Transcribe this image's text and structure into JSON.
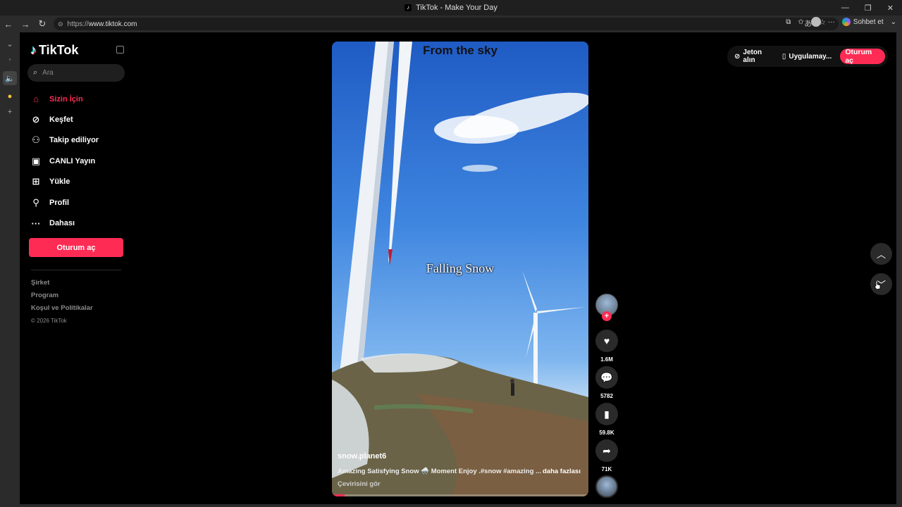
{
  "browser": {
    "window_title": "TikTok - Make Your Day",
    "url_prefix": "https://",
    "url_host": "www.tiktok.com",
    "copilot_label": "Sohbet et"
  },
  "sidebar": {
    "logo_text": "TikTok",
    "search_placeholder": "Ara",
    "nav": [
      {
        "label": "Sizin İçin",
        "icon": "home-icon",
        "active": true
      },
      {
        "label": "Keşfet",
        "icon": "compass-icon"
      },
      {
        "label": "Takip ediliyor",
        "icon": "user-follow-icon"
      },
      {
        "label": "CANLI Yayın",
        "icon": "live-tv-icon"
      },
      {
        "label": "Yükle",
        "icon": "upload-plus-icon"
      },
      {
        "label": "Profil",
        "icon": "person-icon"
      },
      {
        "label": "Dahası",
        "icon": "more-dots-icon"
      }
    ],
    "login_label": "Oturum aç",
    "footer": {
      "company": "Şirket",
      "program": "Program",
      "terms": "Koşul ve Politikalar",
      "copyright": "© 2026 TikTok"
    }
  },
  "video": {
    "caption_top": "From the sky",
    "caption_mid": "Falling Snow",
    "username": "snow.planet6",
    "description": "Amazing Satisfying Snow 🌨️ Moment Enjoy .#snow #amazing ...",
    "more_label": "daha fazlası",
    "translate_label": "Çevirisini gör",
    "progress": 0.05
  },
  "actions": {
    "likes": "1.6M",
    "comments": "5782",
    "saves": "59.8K",
    "shares": "71K"
  },
  "topbar": {
    "coins_label": "Jeton alın",
    "app_label": "Uygulamay...",
    "login_label": "Oturum aç"
  },
  "colors": {
    "accent": "#fe2c55",
    "background": "#000000"
  }
}
